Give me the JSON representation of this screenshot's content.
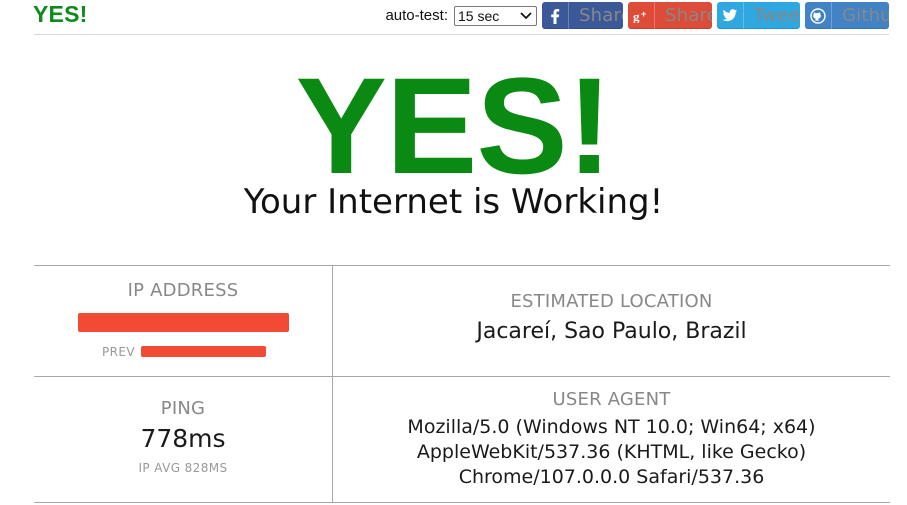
{
  "header": {
    "brand": "YES!",
    "autotest": {
      "label": "auto-test:",
      "selected": "15 sec"
    },
    "share_buttons": [
      {
        "label": "Share",
        "icon": "facebook-icon",
        "color": "#3b5998"
      },
      {
        "label": "Share",
        "icon": "google-plus-icon",
        "color": "#dd4b39"
      },
      {
        "label": "Tweet",
        "icon": "twitter-icon",
        "color": "#2fa7e0"
      },
      {
        "label": "Github",
        "icon": "github-icon",
        "color": "#4183c4"
      }
    ]
  },
  "hero": {
    "title": "YES!",
    "subtitle": "Your Internet is Working!",
    "title_color": "#0a8a13"
  },
  "info": {
    "ip": {
      "label": "IP ADDRESS",
      "prev_label": "PREV"
    },
    "location": {
      "label": "ESTIMATED LOCATION",
      "value": "Jacareí, Sao Paulo, Brazil"
    },
    "ping": {
      "label": "PING",
      "value": "778ms",
      "avg": "IP AVG 828MS"
    },
    "user_agent": {
      "label": "USER AGENT",
      "lines": [
        "Mozilla/5.0 (Windows NT 10.0; Win64; x64)",
        "AppleWebKit/537.36 (KHTML, like Gecko)",
        "Chrome/107.0.0.0 Safari/537.36"
      ]
    }
  },
  "colors": {
    "redaction": "#f14b35",
    "divider": "#a7a7a7"
  }
}
